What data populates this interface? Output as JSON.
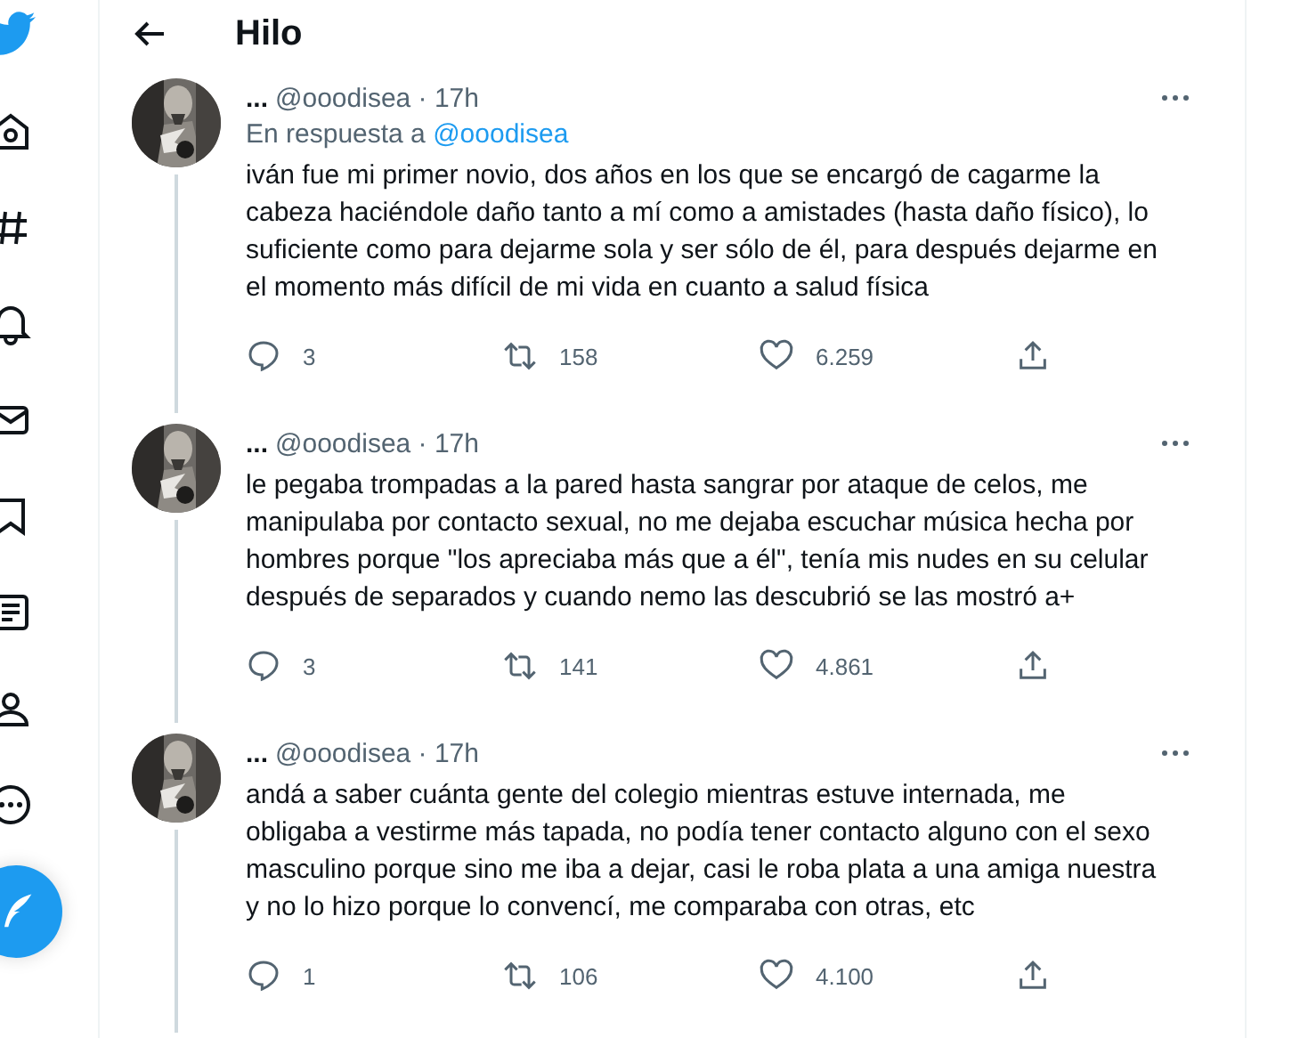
{
  "header": {
    "title": "Hilo"
  },
  "tweets": [
    {
      "name": "...",
      "meta": "@ooodisea · 17h",
      "reply_to": {
        "prefix": "En respuesta a",
        "handle": "@ooodisea"
      },
      "text": "iván fue mi primer novio, dos años en los que se encargó de cagarme la cabeza haciéndole daño tanto a mí como a amistades (hasta daño físico), lo suficiente como para dejarme sola y ser sólo de él, para después dejarme en el momento más difícil de mi vida en cuanto a salud física",
      "replies": "3",
      "retweets": "158",
      "likes": "6.259"
    },
    {
      "name": "...",
      "meta": "@ooodisea · 17h",
      "text": "le pegaba trompadas a la pared hasta sangrar por ataque de celos, me manipulaba por contacto sexual, no me dejaba escuchar música hecha por hombres porque \"los apreciaba más que a él\", tenía mis nudes en su celular después de separados y cuando nemo las descubrió se las mostró a+",
      "replies": "3",
      "retweets": "141",
      "likes": "4.861"
    },
    {
      "name": "...",
      "meta": "@ooodisea · 17h",
      "text": "andá a saber cuánta gente del colegio mientras estuve internada, me obligaba a vestirme más tapada, no podía tener contacto alguno con el sexo masculino porque sino me iba a dejar, casi le roba plata a una amiga nuestra y no lo hizo porque lo convencí, me comparaba con otras, etc",
      "replies": "1",
      "retweets": "106",
      "likes": "4.100"
    }
  ]
}
